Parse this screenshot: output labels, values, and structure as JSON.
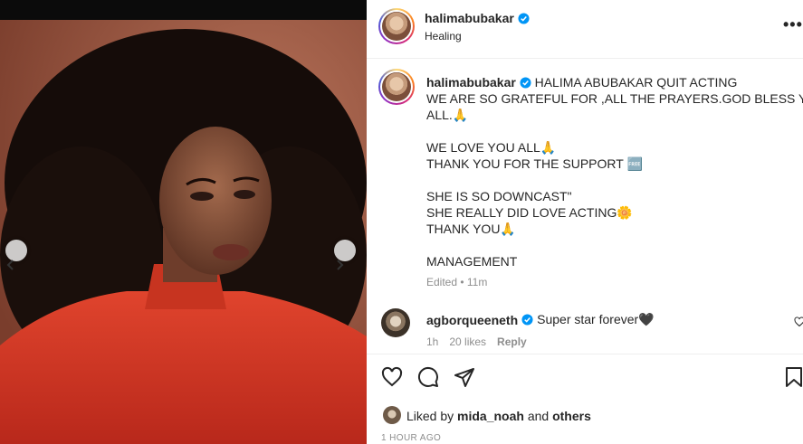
{
  "post": {
    "username": "halimabubakar",
    "location": "Healing",
    "more_label": "•••"
  },
  "caption": {
    "username": "halimabubakar",
    "lines": [
      "HALIMA ABUBAKAR QUIT ACTING",
      "WE ARE SO GRATEFUL FOR ,ALL THE PRAYERS.GOD BLESS YOU",
      "ALL.🙏",
      "",
      "WE LOVE YOU ALL🙏",
      "THANK YOU FOR THE SUPPORT 🆓",
      "",
      "SHE IS SO DOWNCAST\"",
      "SHE REALLY DID LOVE ACTING🌼",
      "THANK YOU🙏",
      "",
      "MANAGEMENT"
    ],
    "edited": "Edited • 11m"
  },
  "comment": {
    "username": "agborqueeneth",
    "text": "Super star forever🖤",
    "time": "1h",
    "likes": "20 likes",
    "reply": "Reply"
  },
  "likes": {
    "prefix": "Liked by",
    "user": "mida_noah",
    "and": "and",
    "others": "others"
  },
  "timestamp": "1 HOUR AGO",
  "icons": {
    "verified": "verified-badge-icon",
    "heart": "heart-icon",
    "comment": "comment-icon",
    "share": "share-icon",
    "save": "bookmark-icon",
    "prev": "chevron-left-icon",
    "next": "chevron-right-icon"
  },
  "colors": {
    "verified": "#0095f6",
    "muted": "#8e8e8e",
    "text": "#262626"
  }
}
